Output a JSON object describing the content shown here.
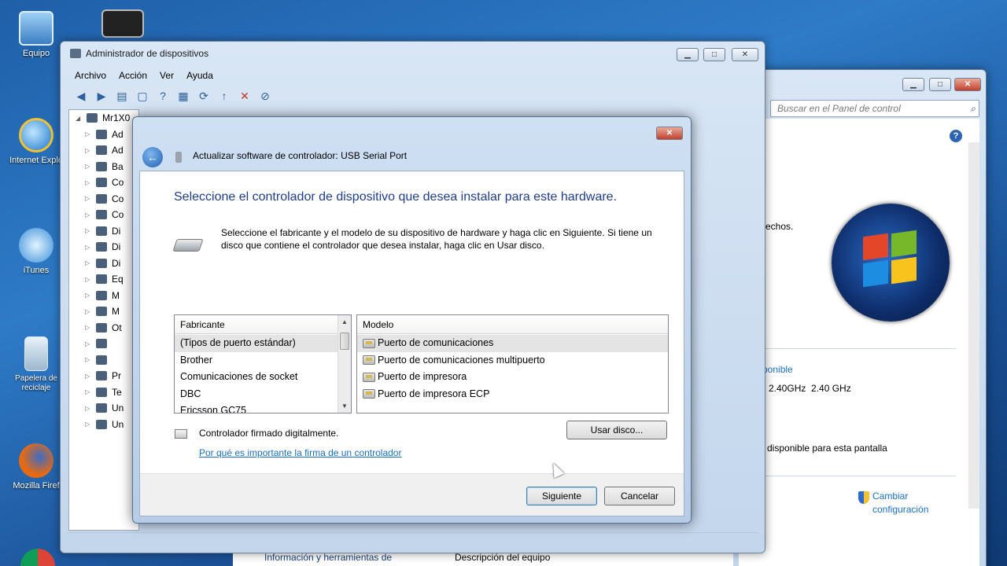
{
  "desktop": {
    "icons": [
      {
        "label": "Equipo"
      },
      {
        "label": ""
      },
      {
        "label": "Internet Explo"
      },
      {
        "label": "iTunes"
      },
      {
        "label": "Papelera de reciclaje"
      },
      {
        "label": "Mozilla Firef"
      }
    ]
  },
  "device_manager": {
    "title": "Administrador de dispositivos",
    "menu": [
      "Archivo",
      "Acción",
      "Ver",
      "Ayuda"
    ],
    "tree_root": "Mr1X0",
    "tree_items": [
      "Ad",
      "Ad",
      "Ba",
      "Co",
      "Co",
      "Co",
      "Di",
      "Di",
      "Di",
      "Eq",
      "M",
      "M",
      "Ot",
      "",
      "",
      "Pr",
      "Te",
      "Un",
      "Un"
    ]
  },
  "control_panel": {
    "search_placeholder": "Buscar en el Panel de control",
    "text_rights": "rechos.",
    "text_available": "ponible",
    "text_cpu": "2.40GHz  2.40 GHz",
    "text_display": "disponible para esta pantalla",
    "change_settings_line1": "Cambiar",
    "change_settings_line2": "configuración",
    "bottom_link": "Información y herramientas de",
    "bottom_text": "Descripción del equipo"
  },
  "dialog": {
    "title": "Actualizar software de controlador: USB Serial Port",
    "heading": "Seleccione el controlador de dispositivo que desea instalar para este hardware.",
    "description": "Seleccione el fabricante y el modelo de su dispositivo de hardware y haga clic en Siguiente. Si tiene un disco que contiene el controlador que desea instalar, haga clic en  Usar disco.",
    "manufacturer_header": "Fabricante",
    "manufacturers": [
      "(Tipos de puerto estándar)",
      "Brother",
      "Comunicaciones de socket",
      "DBC",
      "Ericsson GC75"
    ],
    "model_header": "Modelo",
    "models": [
      "Puerto de comunicaciones",
      "Puerto de comunicaciones multipuerto",
      "Puerto de impresora",
      "Puerto de impresora ECP"
    ],
    "signed_text": "Controlador firmado digitalmente.",
    "signed_link": "Por qué es importante la firma de un controlador",
    "have_disk": "Usar disco...",
    "next": "Siguiente",
    "cancel": "Cancelar"
  }
}
